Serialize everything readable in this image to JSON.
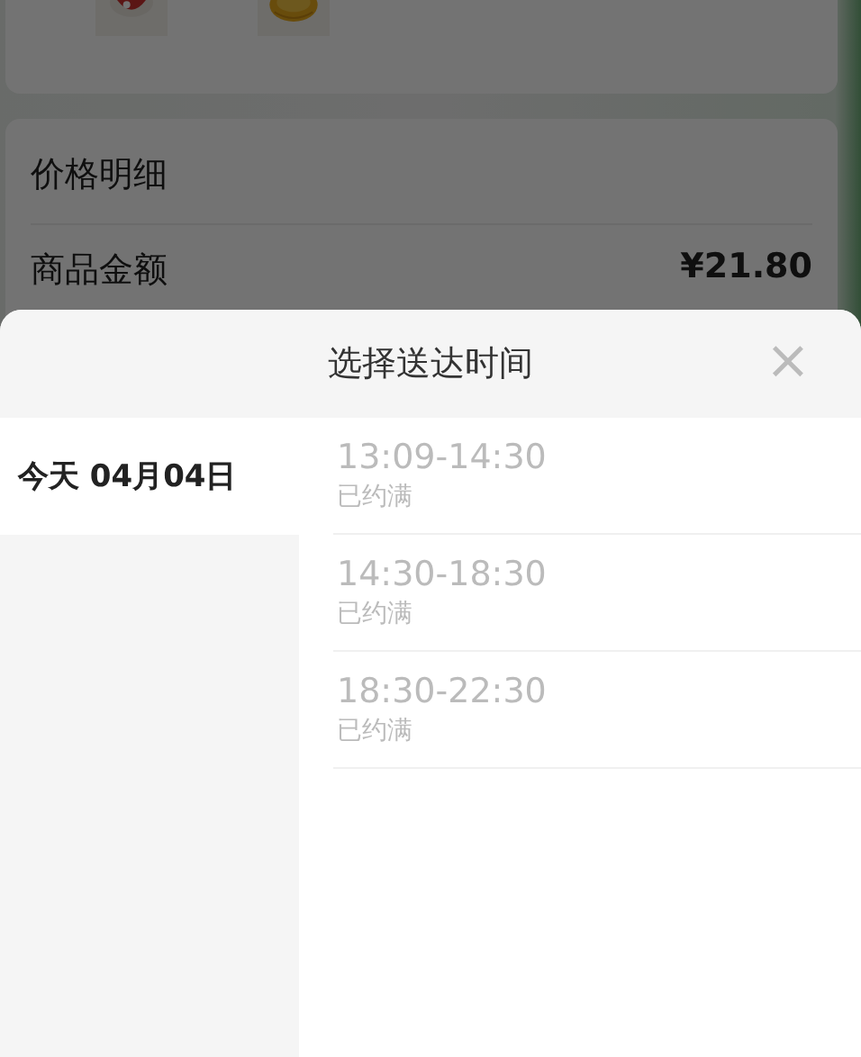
{
  "order_page": {
    "price_card": {
      "title": "价格明细",
      "rows": [
        {
          "label": "商品金额",
          "value": "¥21.80"
        }
      ]
    }
  },
  "sheet": {
    "title": "选择送达时间",
    "close": "×",
    "dates": [
      {
        "label": "今天 04月04日",
        "selected": true
      }
    ],
    "slots": [
      {
        "time": "13:09-14:30",
        "status": "已约满",
        "disabled": true
      },
      {
        "time": "14:30-18:30",
        "status": "已约满",
        "disabled": true
      },
      {
        "time": "18:30-22:30",
        "status": "已约满",
        "disabled": true
      }
    ]
  }
}
